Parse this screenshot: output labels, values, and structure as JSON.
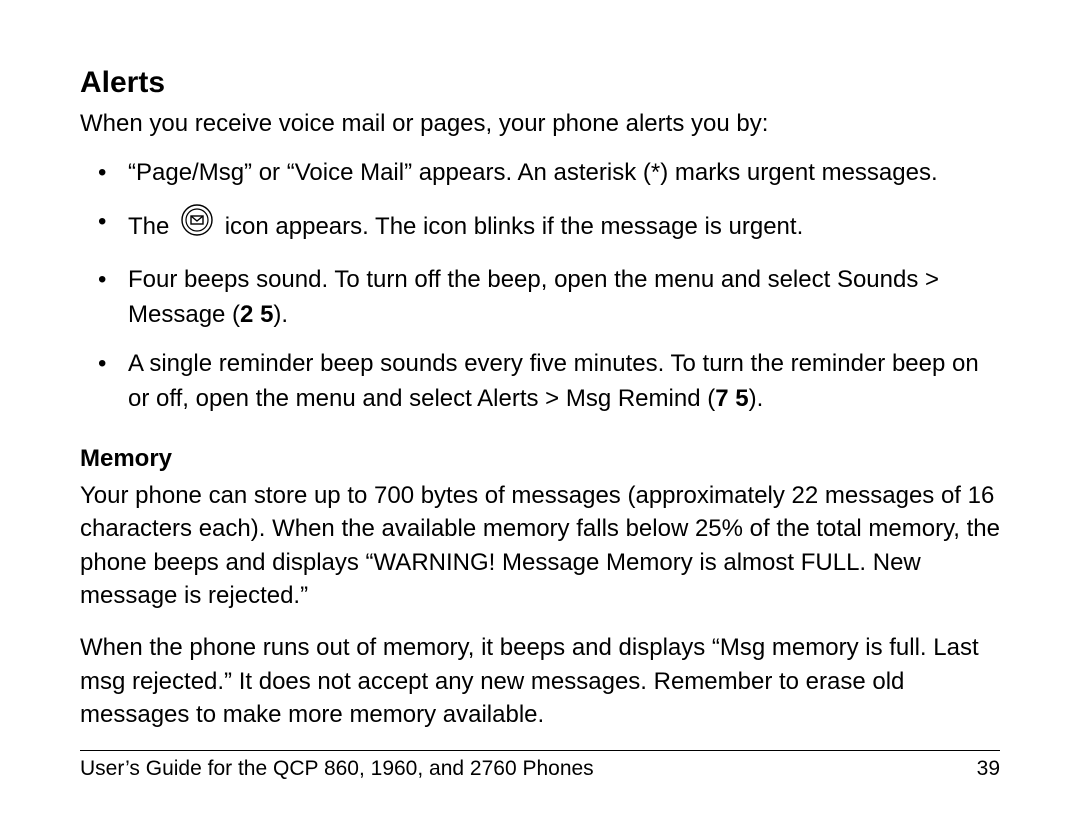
{
  "headings": {
    "alerts": "Alerts",
    "memory": "Memory"
  },
  "alerts": {
    "intro": "When you receive voice mail or pages, your phone alerts you by:",
    "bullets": {
      "b1": "“Page/Msg” or “Voice Mail” appears. An asterisk (*) marks urgent messages.",
      "b2_pre": "The ",
      "b2_post": " icon appears. The icon blinks if the message is urgent.",
      "b3_pre": "Four beeps sound. To turn off the beep, open the menu and select Sounds > Message (",
      "b3_bold": "2 5",
      "b3_post": ").",
      "b4_pre": "A single reminder beep sounds every five minutes. To turn the reminder beep on or off, open the menu and select Alerts > Msg Remind (",
      "b4_bold": "7 5",
      "b4_post": ")."
    }
  },
  "memory": {
    "p1": "Your phone can store up to 700 bytes of messages (approximately 22 messages of 16 characters each). When the available memory falls below 25% of the total memory, the phone beeps and displays “WARNING! Message Memory is almost FULL. New message is rejected.”",
    "p2": "When the phone runs out of memory, it beeps and displays “Msg memory is full. Last msg rejected.” It does not accept any new messages. Remember to erase old messages to make more memory available."
  },
  "footer": {
    "title": "User’s Guide for the QCP 860, 1960, and 2760 Phones",
    "page": "39"
  }
}
